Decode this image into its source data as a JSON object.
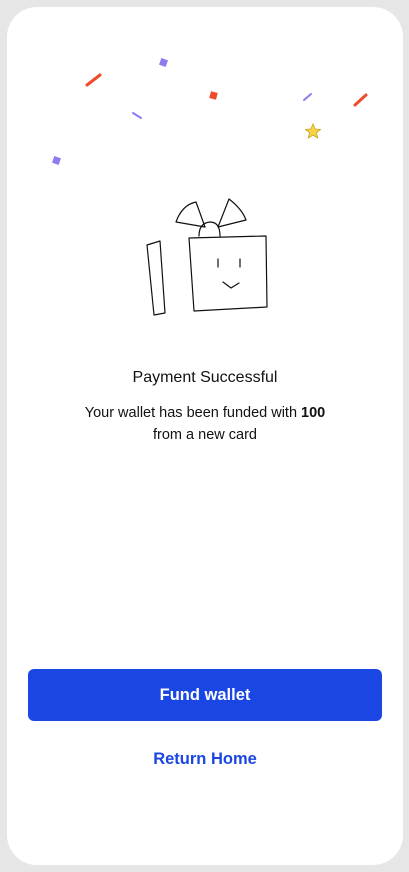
{
  "colors": {
    "primary": "#1a46e3",
    "confetti_red": "#f04a2c",
    "confetti_purple": "#8b7cf0",
    "confetti_star": "#f5d44a",
    "text": "#111111"
  },
  "illustration": {
    "icon": "gift-box-icon"
  },
  "success": {
    "title": "Payment Successful",
    "message_prefix": "Your wallet has been funded with ",
    "amount": "100",
    "message_suffix": "from a new card"
  },
  "actions": {
    "fund_wallet_label": "Fund wallet",
    "return_home_label": "Return Home"
  }
}
